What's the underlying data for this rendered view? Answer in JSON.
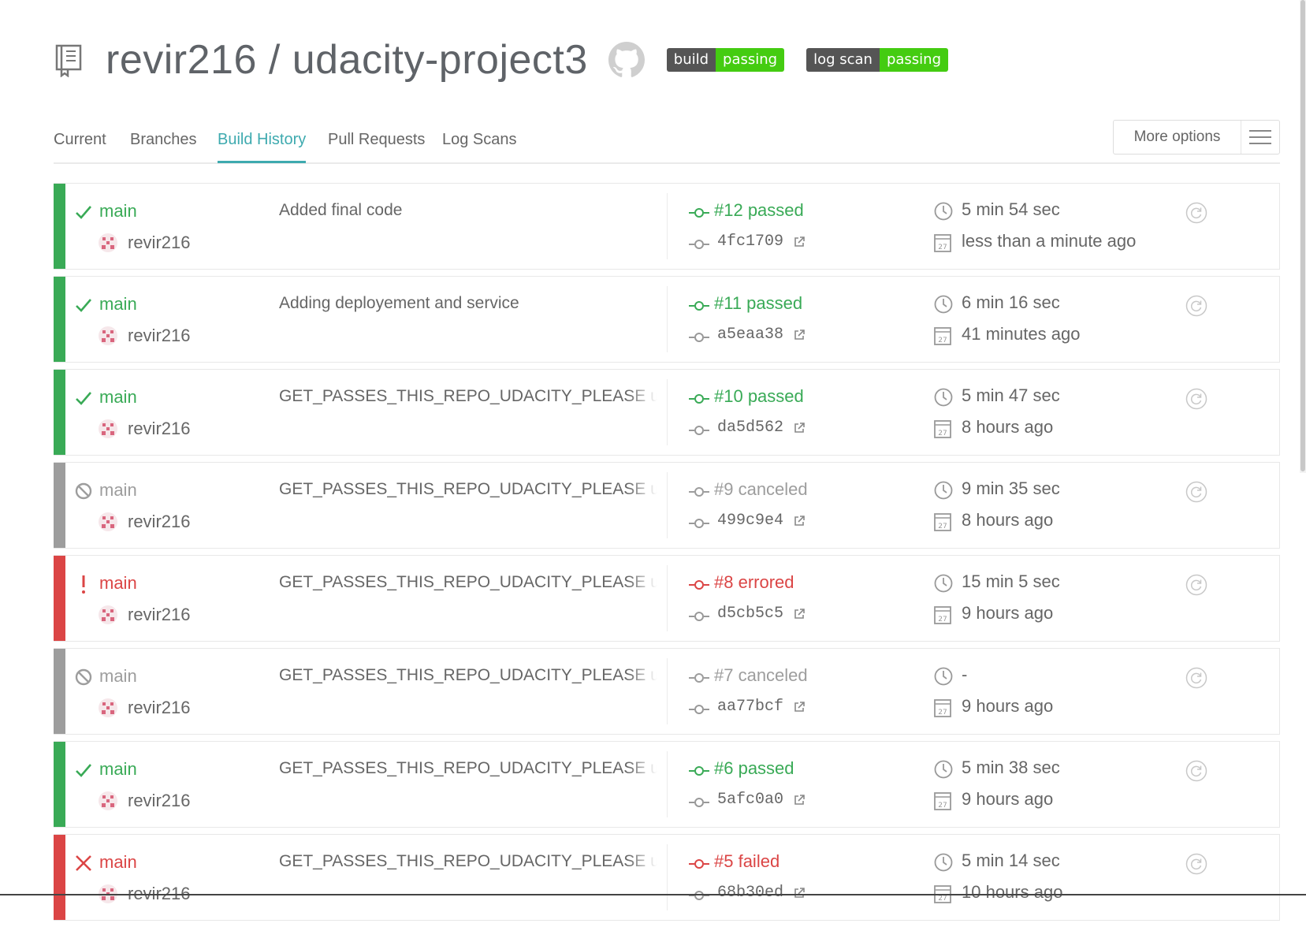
{
  "header": {
    "repo_icon": "repo-book-icon",
    "title": "revir216 / udacity-project3",
    "github_icon": "github-octocat-icon",
    "badges": [
      {
        "label": "build",
        "status": "passing"
      },
      {
        "label": "log scan",
        "status": "passing"
      }
    ]
  },
  "tabs": {
    "items": [
      "Current",
      "Branches",
      "Build History",
      "Pull Requests",
      "Log Scans"
    ],
    "active": "Build History",
    "more_options": "More options",
    "menu_icon": "hamburger-icon"
  },
  "colors": {
    "passed": "#39aa56",
    "canceled": "#9d9d9d",
    "errored": "#db4545",
    "failed": "#db4545",
    "tab_active": "#3eaaaf",
    "badge_key": "#555555",
    "badge_value": "#44cc11"
  },
  "builds": [
    {
      "state": "passed",
      "branch": "main",
      "author": "revir216",
      "message": "Added final code",
      "number": "#12 passed",
      "commit": "4fc1709",
      "duration": "5 min 54 sec",
      "finished": "less than a minute ago"
    },
    {
      "state": "passed",
      "branch": "main",
      "author": "revir216",
      "message": "Adding deployement and service",
      "number": "#11 passed",
      "commit": "a5eaa38",
      "duration": "6 min 16 sec",
      "finished": "41 minutes ago"
    },
    {
      "state": "passed",
      "branch": "main",
      "author": "revir216",
      "message": "GET_PASSES_THIS_REPO_UDACITY_PLEASE update",
      "number": "#10 passed",
      "commit": "da5d562",
      "duration": "5 min 47 sec",
      "finished": "8 hours ago"
    },
    {
      "state": "canceled",
      "branch": "main",
      "author": "revir216",
      "message": "GET_PASSES_THIS_REPO_UDACITY_PLEASE update",
      "number": "#9 canceled",
      "commit": "499c9e4",
      "duration": "9 min 35 sec",
      "finished": "8 hours ago"
    },
    {
      "state": "errored",
      "branch": "main",
      "author": "revir216",
      "message": "GET_PASSES_THIS_REPO_UDACITY_PLEASE update",
      "number": "#8 errored",
      "commit": "d5cb5c5",
      "duration": "15 min 5 sec",
      "finished": "9 hours ago"
    },
    {
      "state": "canceled",
      "branch": "main",
      "author": "revir216",
      "message": "GET_PASSES_THIS_REPO_UDACITY_PLEASE update",
      "number": "#7 canceled",
      "commit": "aa77bcf",
      "duration": "-",
      "finished": "9 hours ago"
    },
    {
      "state": "passed",
      "branch": "main",
      "author": "revir216",
      "message": "GET_PASSES_THIS_REPO_UDACITY_PLEASE update",
      "number": "#6 passed",
      "commit": "5afc0a0",
      "duration": "5 min 38 sec",
      "finished": "9 hours ago"
    },
    {
      "state": "failed",
      "branch": "main",
      "author": "revir216",
      "message": "GET_PASSES_THIS_REPO_UDACITY_PLEASE update",
      "number": "#5 failed",
      "commit": "68b30ed",
      "duration": "5 min 14 sec",
      "finished": "10 hours ago"
    }
  ]
}
